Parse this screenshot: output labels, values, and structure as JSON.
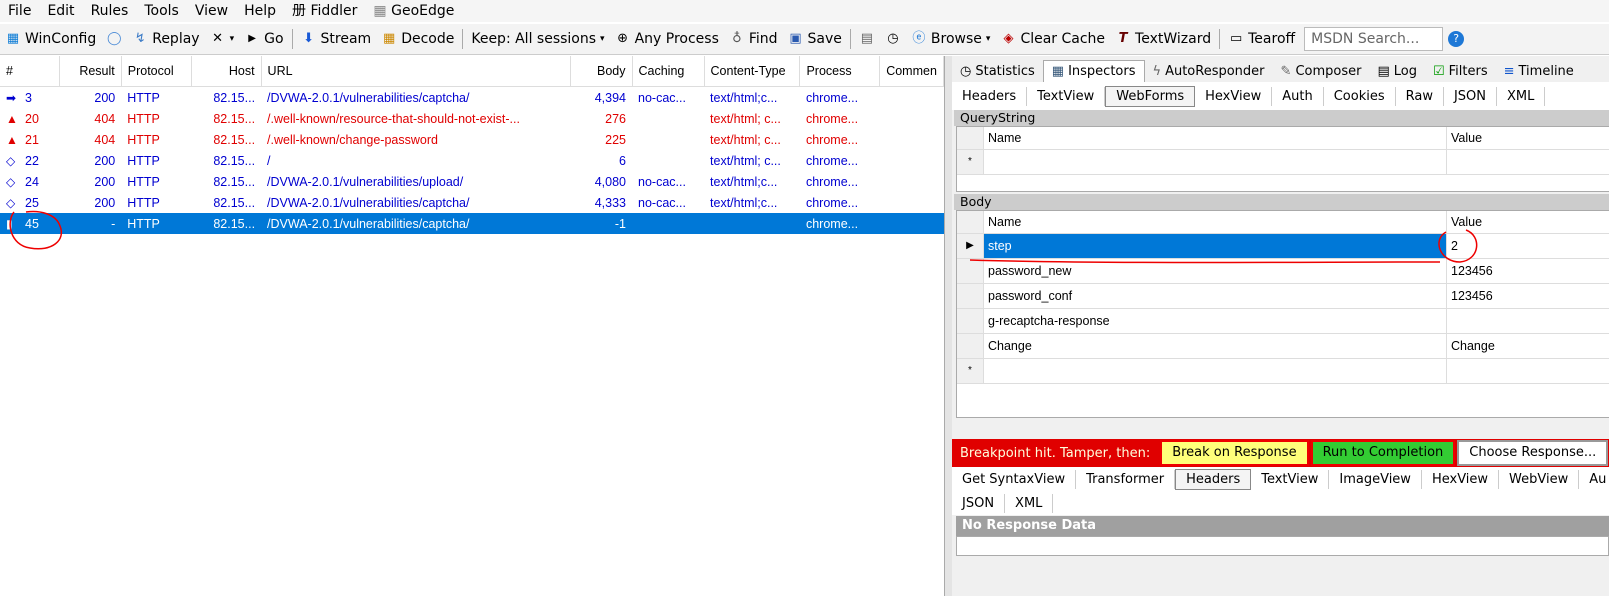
{
  "menu": [
    "File",
    "Edit",
    "Rules",
    "Tools",
    "View",
    "Help",
    "Fiddler",
    "GeoEdge"
  ],
  "toolbar": {
    "winconfig": "WinConfig",
    "replay": "Replay",
    "go": "Go",
    "stream": "Stream",
    "decode": "Decode",
    "keep": "Keep: All sessions",
    "any_process": "Any Process",
    "find": "Find",
    "save": "Save",
    "browse": "Browse",
    "clear_cache": "Clear Cache",
    "textwizard": "TextWizard",
    "tearoff": "Tearoff",
    "search_placeholder": "MSDN Search..."
  },
  "sessions": {
    "columns": [
      "#",
      "Result",
      "Protocol",
      "Host",
      "URL",
      "Body",
      "Caching",
      "Content-Type",
      "Process",
      "Commen"
    ],
    "rows": [
      {
        "num": "3",
        "result": "200",
        "protocol": "HTTP",
        "host": "82.15...",
        "url": "/DVWA-2.0.1/vulnerabilities/captcha/",
        "body": "4,394",
        "caching": "no-cac...",
        "ctype": "text/html;c...",
        "process": "chrome...",
        "style": "blue",
        "icon": "➡"
      },
      {
        "num": "20",
        "result": "404",
        "protocol": "HTTP",
        "host": "82.15...",
        "url": "/.well-known/resource-that-should-not-exist-...",
        "body": "276",
        "caching": "",
        "ctype": "text/html; c...",
        "process": "chrome...",
        "style": "red",
        "icon": "▲"
      },
      {
        "num": "21",
        "result": "404",
        "protocol": "HTTP",
        "host": "82.15...",
        "url": "/.well-known/change-password",
        "body": "225",
        "caching": "",
        "ctype": "text/html; c...",
        "process": "chrome...",
        "style": "red",
        "icon": "▲"
      },
      {
        "num": "22",
        "result": "200",
        "protocol": "HTTP",
        "host": "82.15...",
        "url": "/",
        "body": "6",
        "caching": "",
        "ctype": "text/html; c...",
        "process": "chrome...",
        "style": "blue",
        "icon": "◇"
      },
      {
        "num": "24",
        "result": "200",
        "protocol": "HTTP",
        "host": "82.15...",
        "url": "/DVWA-2.0.1/vulnerabilities/upload/",
        "body": "4,080",
        "caching": "no-cac...",
        "ctype": "text/html;c...",
        "process": "chrome...",
        "style": "blue",
        "icon": "◇"
      },
      {
        "num": "25",
        "result": "200",
        "protocol": "HTTP",
        "host": "82.15...",
        "url": "/DVWA-2.0.1/vulnerabilities/captcha/",
        "body": "4,333",
        "caching": "no-cac...",
        "ctype": "text/html;c...",
        "process": "chrome...",
        "style": "blue",
        "icon": "◇"
      },
      {
        "num": "45",
        "result": "-",
        "protocol": "HTTP",
        "host": "82.15...",
        "url": "/DVWA-2.0.1/vulnerabilities/captcha/",
        "body": "-1",
        "caching": "",
        "ctype": "",
        "process": "chrome...",
        "style": "sel",
        "icon": "▮"
      }
    ]
  },
  "right": {
    "tabs_top": [
      "Statistics",
      "Inspectors",
      "AutoResponder",
      "Composer",
      "Log",
      "Filters",
      "Timeline"
    ],
    "tabs_request": [
      "Headers",
      "TextView",
      "WebForms",
      "HexView",
      "Auth",
      "Cookies",
      "Raw",
      "JSON",
      "XML"
    ],
    "querystring": {
      "title": "QueryString",
      "col_name": "Name",
      "col_value": "Value",
      "new_row_marker": "*"
    },
    "body": {
      "title": "Body",
      "col_name": "Name",
      "col_value": "Value",
      "new_row_marker": "*",
      "rows": [
        {
          "name": "step",
          "value": "2"
        },
        {
          "name": "password_new",
          "value": "123456"
        },
        {
          "name": "password_conf",
          "value": "123456"
        },
        {
          "name": "g-recaptcha-response",
          "value": ""
        },
        {
          "name": "Change",
          "value": "Change"
        }
      ]
    },
    "breakpoint": {
      "text": "Breakpoint hit. Tamper, then:",
      "break_on_response": "Break on Response",
      "run_to_completion": "Run to Completion",
      "choose_response": "Choose Response..."
    },
    "tabs_response": [
      "Get SyntaxView",
      "Transformer",
      "Headers",
      "TextView",
      "ImageView",
      "HexView",
      "WebView",
      "Au"
    ],
    "tabs_response2": [
      "JSON",
      "XML"
    ],
    "no_response": "No Response Data"
  }
}
